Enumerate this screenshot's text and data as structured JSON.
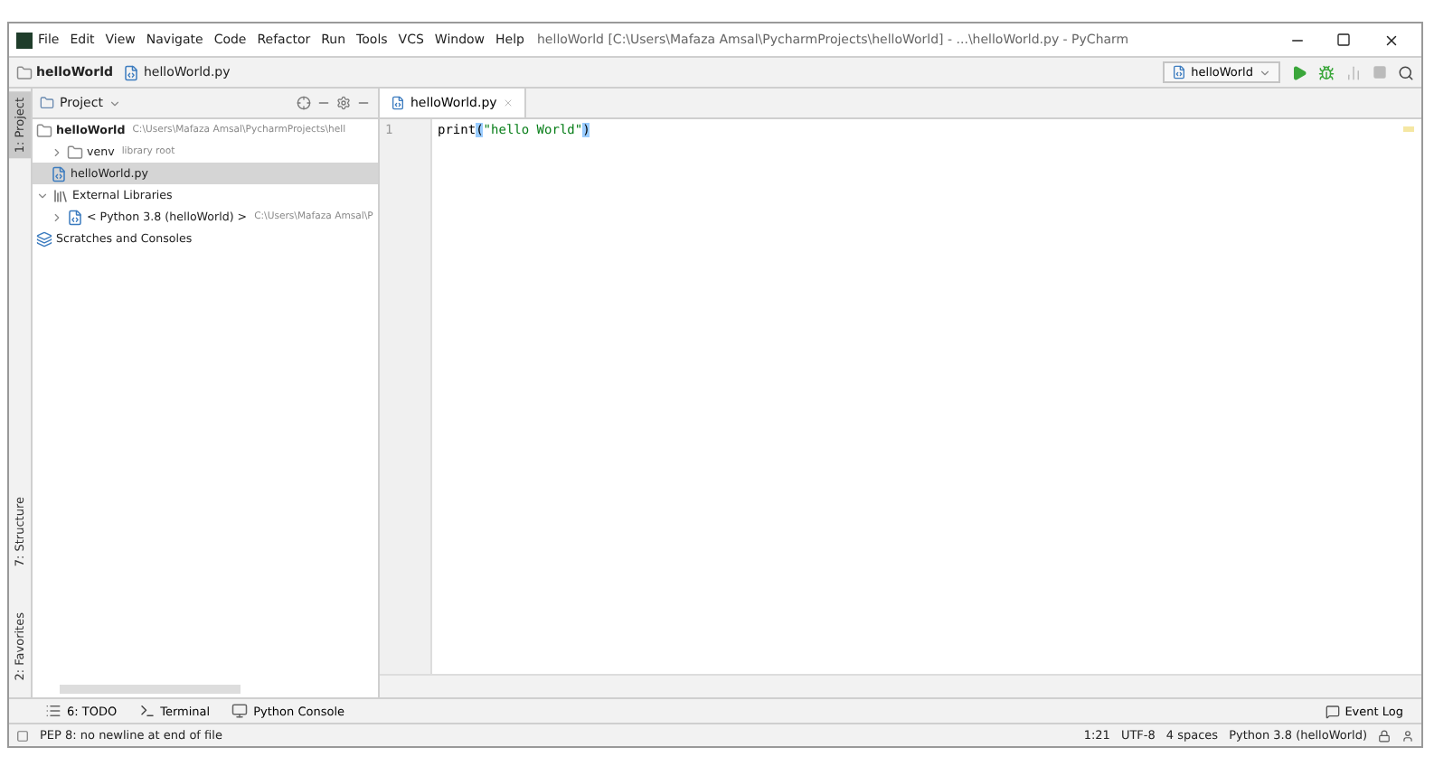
{
  "window": {
    "title": "helloWorld [C:\\Users\\Mafaza Amsal\\PycharmProjects\\helloWorld] - ...\\helloWorld.py - PyCharm"
  },
  "menu": [
    "File",
    "Edit",
    "View",
    "Navigate",
    "Code",
    "Refactor",
    "Run",
    "Tools",
    "VCS",
    "Window",
    "Help"
  ],
  "breadcrumbs": [
    {
      "label": "helloWorld",
      "kind": "folder"
    },
    {
      "label": "helloWorld.py",
      "kind": "file"
    }
  ],
  "run_config": {
    "label": "helloWorld"
  },
  "side_tabs": [
    {
      "label": "1: Project",
      "selected": true
    },
    {
      "label": "7: Structure",
      "selected": false
    },
    {
      "label": "2: Favorites",
      "selected": false
    }
  ],
  "project_panel": {
    "title": "Project",
    "tree": [
      {
        "label": "helloWorld",
        "hint": "C:\\Users\\Mafaza Amsal\\PycharmProjects\\hell",
        "kind": "project",
        "expanded": true,
        "selected": false,
        "children": [
          {
            "label": "venv",
            "hint": "library root",
            "kind": "folder",
            "expanded": false,
            "selected": false
          },
          {
            "label": "helloWorld.py",
            "kind": "file",
            "selected": true
          }
        ]
      },
      {
        "label": "External Libraries",
        "kind": "libraries",
        "expanded": true,
        "selected": false,
        "children": [
          {
            "label": "< Python 3.8 (helloWorld) >",
            "hint": "C:\\Users\\Mafaza Amsal\\P",
            "kind": "python",
            "expanded": false,
            "selected": false
          }
        ]
      },
      {
        "label": "Scratches and Consoles",
        "kind": "scratches",
        "selected": false
      }
    ]
  },
  "editor": {
    "tabs": [
      {
        "label": "helloWorld.py",
        "selected": true
      }
    ],
    "lines": [
      {
        "number": "1",
        "tokens": [
          {
            "text": "print",
            "kind": "plain"
          },
          {
            "text": "(",
            "kind": "brace"
          },
          {
            "text": "\"hello World\"",
            "kind": "string"
          },
          {
            "text": ")",
            "kind": "brace"
          }
        ]
      }
    ]
  },
  "tool_windows": [
    {
      "label": "6: TODO",
      "kind": "todo"
    },
    {
      "label": "Terminal",
      "kind": "terminal"
    },
    {
      "label": "Python Console",
      "kind": "python"
    }
  ],
  "event_log": "Event Log",
  "status_bar": {
    "message": "PEP 8: no newline at end of file",
    "items": [
      "1:21",
      "UTF-8",
      "4 spaces",
      "Python 3.8 (helloWorld)"
    ]
  }
}
